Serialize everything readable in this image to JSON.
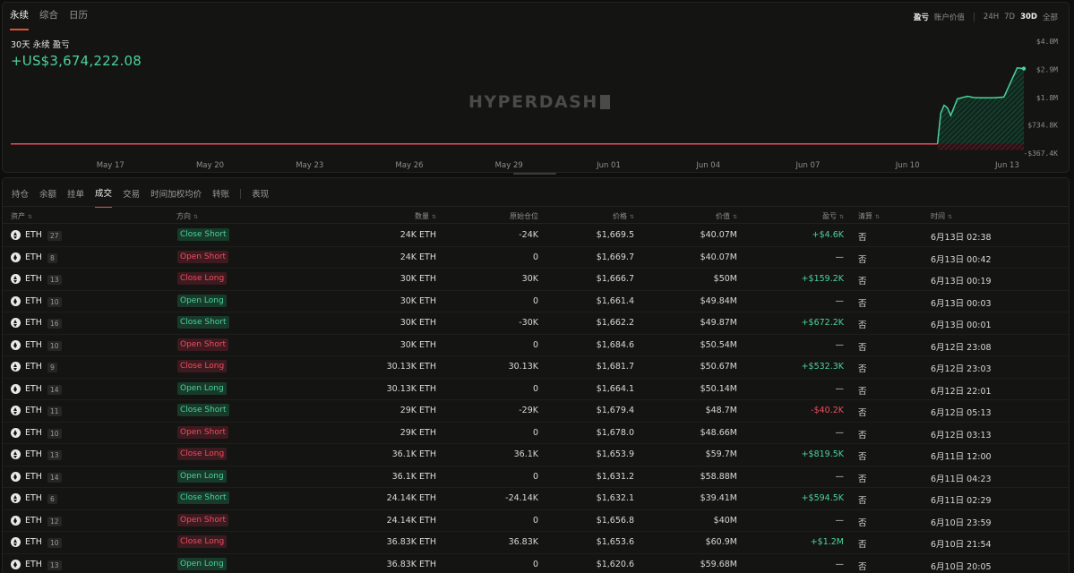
{
  "top_tabs": [
    "永续",
    "综合",
    "日历"
  ],
  "controls": {
    "metric_pnl": "盈亏",
    "metric_account": "账户价值",
    "ranges": [
      "24H",
      "7D",
      "30D",
      "全部"
    ],
    "active_range": "30D"
  },
  "summary": {
    "label": "30天 永续 盈亏",
    "value": "+US$3,674,222.08"
  },
  "watermark": "HYPERDASH",
  "chart_data": {
    "type": "area",
    "title": "",
    "x_ticks": [
      "May 17",
      "May 20",
      "May 23",
      "May 26",
      "May 29",
      "Jun 01",
      "Jun 04",
      "Jun 07",
      "Jun 10",
      "Jun 13"
    ],
    "y_ticks": [
      "$4.0M",
      "$2.9M",
      "$1.8M",
      "$734.8K",
      "-$367.4K"
    ],
    "ylim": [
      -367400,
      4000000
    ],
    "series": [
      {
        "x": [
          "May 14",
          "May 20",
          "May 26",
          "Jun 01",
          "Jun 07",
          "Jun 10.9",
          "Jun 11.0",
          "Jun 11.1",
          "Jun 11.2",
          "Jun 11.3",
          "Jun 11.5",
          "Jun 11.8",
          "Jun 12.0",
          "Jun 12.2",
          "Jun 12.6",
          "Jun 12.9",
          "Jun 13.3",
          "Jun 13.5"
        ],
        "values": [
          -10000,
          -10000,
          -10000,
          -10000,
          -10000,
          -10000,
          1200000,
          1500000,
          1400000,
          1100000,
          1750000,
          1850000,
          1800000,
          1790000,
          1790000,
          1820000,
          2960000,
          2930000
        ]
      }
    ],
    "colors": {
      "positive": "#4bd39a",
      "negative": "#ef4c5f"
    }
  },
  "sub_tabs": [
    "持仓",
    "余额",
    "挂单",
    "成交",
    "交易",
    "时间加权均价",
    "转账",
    "表现"
  ],
  "active_sub_tab": "成交",
  "table": {
    "headers": {
      "asset": "资产",
      "direction": "方向",
      "qty": "数量",
      "orig_pos": "原始仓位",
      "price": "价格",
      "value": "价值",
      "pnl": "盈亏",
      "liq": "清算",
      "time": "时间"
    },
    "rows": [
      {
        "asset": "ETH",
        "count": "27",
        "dir": "Close Short",
        "side": "green",
        "qty": "24K ETH",
        "orig": "-24K",
        "price": "$1,669.5",
        "value": "$40.07M",
        "pnl": "+$4.6K",
        "pnl_sign": "pos",
        "liq": "否",
        "time": "6月13日 02:38"
      },
      {
        "asset": "ETH",
        "count": "8",
        "dir": "Open Short",
        "side": "red",
        "qty": "24K ETH",
        "orig": "0",
        "price": "$1,669.7",
        "value": "$40.07M",
        "pnl": "—",
        "pnl_sign": "dash",
        "liq": "否",
        "time": "6月13日 00:42"
      },
      {
        "asset": "ETH",
        "count": "13",
        "dir": "Close Long",
        "side": "red",
        "qty": "30K ETH",
        "orig": "30K",
        "price": "$1,666.7",
        "value": "$50M",
        "pnl": "+$159.2K",
        "pnl_sign": "pos",
        "liq": "否",
        "time": "6月13日 00:19"
      },
      {
        "asset": "ETH",
        "count": "10",
        "dir": "Open Long",
        "side": "green",
        "qty": "30K ETH",
        "orig": "0",
        "price": "$1,661.4",
        "value": "$49.84M",
        "pnl": "—",
        "pnl_sign": "dash",
        "liq": "否",
        "time": "6月13日 00:03"
      },
      {
        "asset": "ETH",
        "count": "16",
        "dir": "Close Short",
        "side": "green",
        "qty": "30K ETH",
        "orig": "-30K",
        "price": "$1,662.2",
        "value": "$49.87M",
        "pnl": "+$672.2K",
        "pnl_sign": "pos",
        "liq": "否",
        "time": "6月13日 00:01"
      },
      {
        "asset": "ETH",
        "count": "10",
        "dir": "Open Short",
        "side": "red",
        "qty": "30K ETH",
        "orig": "0",
        "price": "$1,684.6",
        "value": "$50.54M",
        "pnl": "—",
        "pnl_sign": "dash",
        "liq": "否",
        "time": "6月12日 23:08"
      },
      {
        "asset": "ETH",
        "count": "9",
        "dir": "Close Long",
        "side": "red",
        "qty": "30.13K ETH",
        "orig": "30.13K",
        "price": "$1,681.7",
        "value": "$50.67M",
        "pnl": "+$532.3K",
        "pnl_sign": "pos",
        "liq": "否",
        "time": "6月12日 23:03"
      },
      {
        "asset": "ETH",
        "count": "14",
        "dir": "Open Long",
        "side": "green",
        "qty": "30.13K ETH",
        "orig": "0",
        "price": "$1,664.1",
        "value": "$50.14M",
        "pnl": "—",
        "pnl_sign": "dash",
        "liq": "否",
        "time": "6月12日 22:01"
      },
      {
        "asset": "ETH",
        "count": "11",
        "dir": "Close Short",
        "side": "green",
        "qty": "29K ETH",
        "orig": "-29K",
        "price": "$1,679.4",
        "value": "$48.7M",
        "pnl": "-$40.2K",
        "pnl_sign": "neg",
        "liq": "否",
        "time": "6月12日 05:13"
      },
      {
        "asset": "ETH",
        "count": "10",
        "dir": "Open Short",
        "side": "red",
        "qty": "29K ETH",
        "orig": "0",
        "price": "$1,678.0",
        "value": "$48.66M",
        "pnl": "—",
        "pnl_sign": "dash",
        "liq": "否",
        "time": "6月12日 03:13"
      },
      {
        "asset": "ETH",
        "count": "13",
        "dir": "Close Long",
        "side": "red",
        "qty": "36.1K ETH",
        "orig": "36.1K",
        "price": "$1,653.9",
        "value": "$59.7M",
        "pnl": "+$819.5K",
        "pnl_sign": "pos",
        "liq": "否",
        "time": "6月11日 12:00"
      },
      {
        "asset": "ETH",
        "count": "14",
        "dir": "Open Long",
        "side": "green",
        "qty": "36.1K ETH",
        "orig": "0",
        "price": "$1,631.2",
        "value": "$58.88M",
        "pnl": "—",
        "pnl_sign": "dash",
        "liq": "否",
        "time": "6月11日 04:23"
      },
      {
        "asset": "ETH",
        "count": "6",
        "dir": "Close Short",
        "side": "green",
        "qty": "24.14K ETH",
        "orig": "-24.14K",
        "price": "$1,632.1",
        "value": "$39.41M",
        "pnl": "+$594.5K",
        "pnl_sign": "pos",
        "liq": "否",
        "time": "6月11日 02:29"
      },
      {
        "asset": "ETH",
        "count": "12",
        "dir": "Open Short",
        "side": "red",
        "qty": "24.14K ETH",
        "orig": "0",
        "price": "$1,656.8",
        "value": "$40M",
        "pnl": "—",
        "pnl_sign": "dash",
        "liq": "否",
        "time": "6月10日 23:59"
      },
      {
        "asset": "ETH",
        "count": "10",
        "dir": "Close Long",
        "side": "red",
        "qty": "36.83K ETH",
        "orig": "36.83K",
        "price": "$1,653.6",
        "value": "$60.9M",
        "pnl": "+$1.2M",
        "pnl_sign": "pos",
        "liq": "否",
        "time": "6月10日 21:54"
      },
      {
        "asset": "ETH",
        "count": "13",
        "dir": "Open Long",
        "side": "green",
        "qty": "36.83K ETH",
        "orig": "0",
        "price": "$1,620.6",
        "value": "$59.68M",
        "pnl": "—",
        "pnl_sign": "dash",
        "liq": "否",
        "time": "6月10日 20:05"
      }
    ]
  }
}
